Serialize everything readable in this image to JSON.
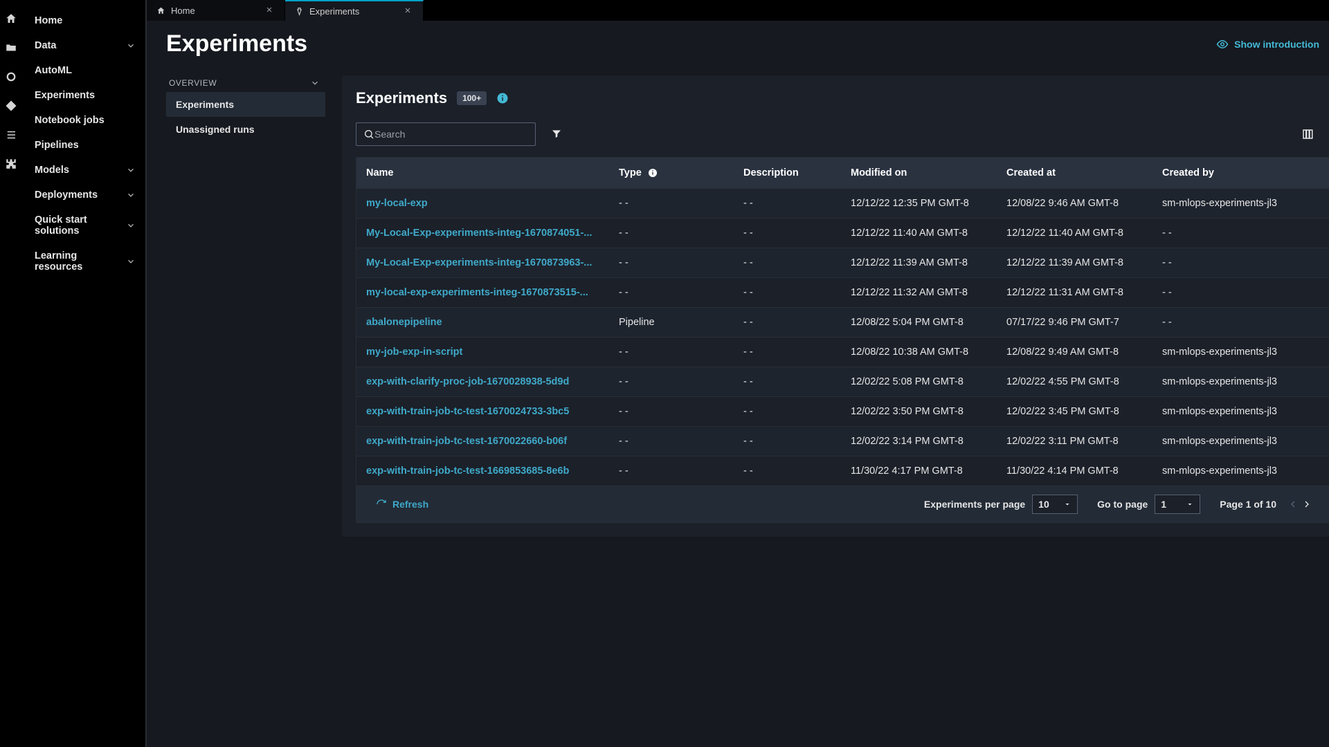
{
  "nav": {
    "items": [
      {
        "label": "Home",
        "expandable": false
      },
      {
        "label": "Data",
        "expandable": true
      },
      {
        "label": "AutoML",
        "expandable": false
      },
      {
        "label": "Experiments",
        "expandable": false
      },
      {
        "label": "Notebook jobs",
        "expandable": false
      },
      {
        "label": "Pipelines",
        "expandable": false
      },
      {
        "label": "Models",
        "expandable": true
      },
      {
        "label": "Deployments",
        "expandable": true
      },
      {
        "label": "Quick start solutions",
        "expandable": true
      },
      {
        "label": "Learning resources",
        "expandable": true
      }
    ]
  },
  "tabs": [
    {
      "label": "Home",
      "active": false
    },
    {
      "label": "Experiments",
      "active": true
    }
  ],
  "page": {
    "title": "Experiments",
    "show_intro": "Show introduction"
  },
  "overview": {
    "header": "OVERVIEW",
    "items": [
      {
        "label": "Experiments",
        "active": true
      },
      {
        "label": "Unassigned runs",
        "active": false
      }
    ]
  },
  "card": {
    "title": "Experiments",
    "count_badge": "100+",
    "search_placeholder": "Search"
  },
  "table": {
    "columns": [
      "Name",
      "Type",
      "Description",
      "Modified on",
      "Created at",
      "Created by"
    ],
    "rows": [
      {
        "name": "my-local-exp",
        "type": "- -",
        "desc": "- -",
        "modified": "12/12/22 12:35 PM GMT-8",
        "created": "12/08/22 9:46 AM GMT-8",
        "by": "sm-mlops-experiments-jl3"
      },
      {
        "name": "My-Local-Exp-experiments-integ-1670874051-...",
        "type": "- -",
        "desc": "- -",
        "modified": "12/12/22 11:40 AM GMT-8",
        "created": "12/12/22 11:40 AM GMT-8",
        "by": "- -"
      },
      {
        "name": "My-Local-Exp-experiments-integ-1670873963-...",
        "type": "- -",
        "desc": "- -",
        "modified": "12/12/22 11:39 AM GMT-8",
        "created": "12/12/22 11:39 AM GMT-8",
        "by": "- -"
      },
      {
        "name": "my-local-exp-experiments-integ-1670873515-...",
        "type": "- -",
        "desc": "- -",
        "modified": "12/12/22 11:32 AM GMT-8",
        "created": "12/12/22 11:31 AM GMT-8",
        "by": "- -"
      },
      {
        "name": "abalonepipeline",
        "type": "Pipeline",
        "desc": "- -",
        "modified": "12/08/22 5:04 PM GMT-8",
        "created": "07/17/22 9:46 PM GMT-7",
        "by": "- -"
      },
      {
        "name": "my-job-exp-in-script",
        "type": "- -",
        "desc": "- -",
        "modified": "12/08/22 10:38 AM GMT-8",
        "created": "12/08/22 9:49 AM GMT-8",
        "by": "sm-mlops-experiments-jl3"
      },
      {
        "name": "exp-with-clarify-proc-job-1670028938-5d9d",
        "type": "- -",
        "desc": "- -",
        "modified": "12/02/22 5:08 PM GMT-8",
        "created": "12/02/22 4:55 PM GMT-8",
        "by": "sm-mlops-experiments-jl3"
      },
      {
        "name": "exp-with-train-job-tc-test-1670024733-3bc5",
        "type": "- -",
        "desc": "- -",
        "modified": "12/02/22 3:50 PM GMT-8",
        "created": "12/02/22 3:45 PM GMT-8",
        "by": "sm-mlops-experiments-jl3"
      },
      {
        "name": "exp-with-train-job-tc-test-1670022660-b06f",
        "type": "- -",
        "desc": "- -",
        "modified": "12/02/22 3:14 PM GMT-8",
        "created": "12/02/22 3:11 PM GMT-8",
        "by": "sm-mlops-experiments-jl3"
      },
      {
        "name": "exp-with-train-job-tc-test-1669853685-8e6b",
        "type": "- -",
        "desc": "- -",
        "modified": "11/30/22 4:17 PM GMT-8",
        "created": "11/30/22 4:14 PM GMT-8",
        "by": "sm-mlops-experiments-jl3"
      }
    ]
  },
  "footer": {
    "refresh": "Refresh",
    "per_page_label": "Experiments per page",
    "per_page_value": "10",
    "goto_label": "Go to page",
    "goto_value": "1",
    "page_indicator": "Page 1 of 10"
  }
}
